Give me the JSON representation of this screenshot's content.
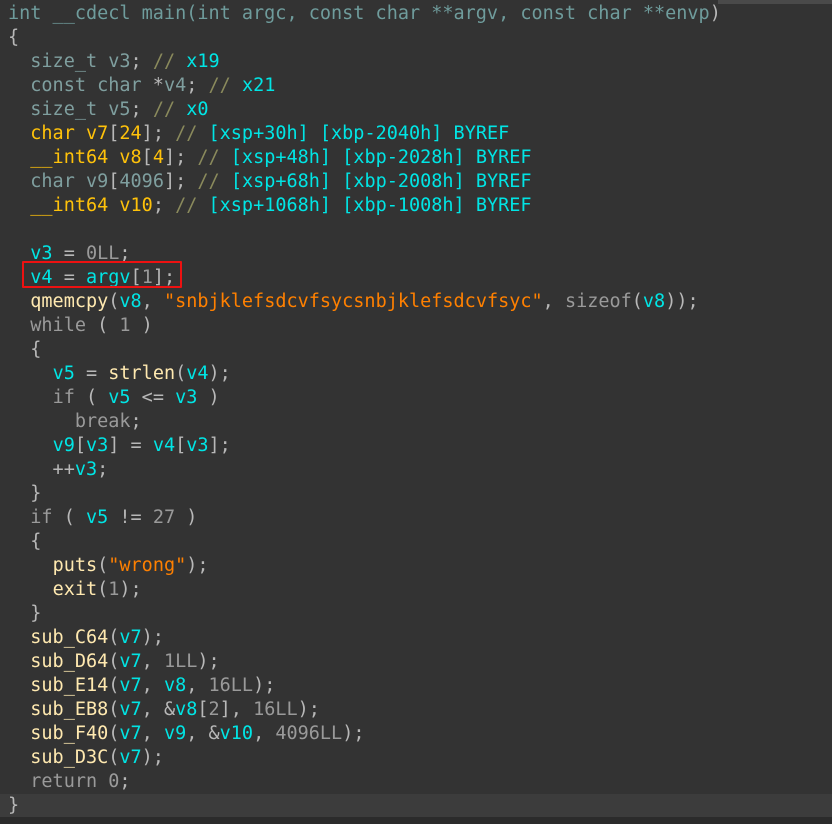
{
  "view": {
    "name": "pseudocode-view",
    "theme": "dark",
    "background_color": "#333333",
    "current_line_background": "#3c3c3c"
  },
  "colors": {
    "prototype": "#6f9c9c",
    "punctuation": "#b8b8b8",
    "keyword": "#9a9a9a",
    "type": "#7f9f9f",
    "stack_variable": "#ffc20a",
    "number": "#9a9a9a",
    "comment": "#8a8a5c",
    "address_comment": "#00e5e5",
    "variable": "#00e5e5",
    "function": "#ffe9b0",
    "string_literal": "#ff8000",
    "highlight_rectangle": "#ee1111"
  },
  "highlight": {
    "name": "red-annotation-rectangle",
    "target_line_index": 11,
    "target_text": "v4 = argv[1];"
  },
  "code": {
    "lines": [
      {
        "index": 0,
        "text": "int __cdecl main(int argc, const char **argv, const char **envp)",
        "tokens": [
          {
            "t": "int __cdecl main(int argc, const char **argv, const char **envp",
            "c": "t-proto"
          },
          {
            "t": ")",
            "c": "t-punct"
          }
        ]
      },
      {
        "index": 1,
        "text": "{",
        "tokens": [
          {
            "t": "{",
            "c": "t-punct"
          }
        ]
      },
      {
        "index": 2,
        "text": "  size_t v3; // x19",
        "tokens": [
          {
            "t": "  ",
            "c": "t-punct"
          },
          {
            "t": "size_t",
            "c": "t-type"
          },
          {
            "t": " ",
            "c": "t-punct"
          },
          {
            "t": "v3",
            "c": "t-localvar"
          },
          {
            "t": "; ",
            "c": "t-punct"
          },
          {
            "t": "//",
            "c": "t-comment"
          },
          {
            "t": " ",
            "c": "t-punct"
          },
          {
            "t": "x19",
            "c": "t-addr"
          }
        ]
      },
      {
        "index": 3,
        "text": "  const char *v4; // x21",
        "tokens": [
          {
            "t": "  ",
            "c": "t-punct"
          },
          {
            "t": "const char",
            "c": "t-type"
          },
          {
            "t": " *",
            "c": "t-punct"
          },
          {
            "t": "v4",
            "c": "t-localvar"
          },
          {
            "t": "; ",
            "c": "t-punct"
          },
          {
            "t": "//",
            "c": "t-comment"
          },
          {
            "t": " ",
            "c": "t-punct"
          },
          {
            "t": "x21",
            "c": "t-addr"
          }
        ]
      },
      {
        "index": 4,
        "text": "  size_t v5; // x0",
        "tokens": [
          {
            "t": "  ",
            "c": "t-punct"
          },
          {
            "t": "size_t",
            "c": "t-type"
          },
          {
            "t": " ",
            "c": "t-punct"
          },
          {
            "t": "v5",
            "c": "t-localvar"
          },
          {
            "t": "; ",
            "c": "t-punct"
          },
          {
            "t": "//",
            "c": "t-comment"
          },
          {
            "t": " ",
            "c": "t-punct"
          },
          {
            "t": "x0",
            "c": "t-addr"
          }
        ]
      },
      {
        "index": 5,
        "text": "  char v7[24]; // [xsp+30h] [xbp-2040h] BYREF",
        "tokens": [
          {
            "t": "  ",
            "c": "t-punct"
          },
          {
            "t": "char v7",
            "c": "t-stackvar"
          },
          {
            "t": "[",
            "c": "t-punct"
          },
          {
            "t": "24",
            "c": "t-stackvar"
          },
          {
            "t": "]",
            "c": "t-punct"
          },
          {
            "t": "; ",
            "c": "t-punct"
          },
          {
            "t": "//",
            "c": "t-comment"
          },
          {
            "t": " ",
            "c": "t-punct"
          },
          {
            "t": "[xsp+30h] [xbp-2040h] BYREF",
            "c": "t-addr"
          }
        ]
      },
      {
        "index": 6,
        "text": "  __int64 v8[4]; // [xsp+48h] [xbp-2028h] BYREF",
        "tokens": [
          {
            "t": "  ",
            "c": "t-punct"
          },
          {
            "t": "__int64 v8",
            "c": "t-stackvar"
          },
          {
            "t": "[",
            "c": "t-punct"
          },
          {
            "t": "4",
            "c": "t-stackvar"
          },
          {
            "t": "]",
            "c": "t-punct"
          },
          {
            "t": "; ",
            "c": "t-punct"
          },
          {
            "t": "//",
            "c": "t-comment"
          },
          {
            "t": " ",
            "c": "t-punct"
          },
          {
            "t": "[xsp+48h] [xbp-2028h] BYREF",
            "c": "t-addr"
          }
        ]
      },
      {
        "index": 7,
        "text": "  char v9[4096]; // [xsp+68h] [xbp-2008h] BYREF",
        "tokens": [
          {
            "t": "  ",
            "c": "t-punct"
          },
          {
            "t": "char",
            "c": "t-type"
          },
          {
            "t": " ",
            "c": "t-punct"
          },
          {
            "t": "v9",
            "c": "t-localvar"
          },
          {
            "t": "[",
            "c": "t-punct"
          },
          {
            "t": "4096",
            "c": "t-localvar"
          },
          {
            "t": "]",
            "c": "t-punct"
          },
          {
            "t": "; ",
            "c": "t-punct"
          },
          {
            "t": "//",
            "c": "t-comment"
          },
          {
            "t": " ",
            "c": "t-punct"
          },
          {
            "t": "[xsp+68h] [xbp-2008h] BYREF",
            "c": "t-addr"
          }
        ]
      },
      {
        "index": 8,
        "text": "  __int64 v10; // [xsp+1068h] [xbp-1008h] BYREF",
        "tokens": [
          {
            "t": "  ",
            "c": "t-punct"
          },
          {
            "t": "__int64 v10",
            "c": "t-stackvar"
          },
          {
            "t": "; ",
            "c": "t-punct"
          },
          {
            "t": "//",
            "c": "t-comment"
          },
          {
            "t": " ",
            "c": "t-punct"
          },
          {
            "t": "[xsp+1068h] [xbp-1008h] BYREF",
            "c": "t-addr"
          }
        ]
      },
      {
        "index": 9,
        "text": "",
        "tokens": []
      },
      {
        "index": 10,
        "text": "  v3 = 0LL;",
        "tokens": [
          {
            "t": "  ",
            "c": "t-punct"
          },
          {
            "t": "v3",
            "c": "t-var"
          },
          {
            "t": " = ",
            "c": "t-punct"
          },
          {
            "t": "0LL",
            "c": "t-number"
          },
          {
            "t": ";",
            "c": "t-punct"
          }
        ]
      },
      {
        "index": 11,
        "text": "  v4 = argv[1];",
        "tokens": [
          {
            "t": "  ",
            "c": "t-punct"
          },
          {
            "t": "v4",
            "c": "t-var"
          },
          {
            "t": " = ",
            "c": "t-punct"
          },
          {
            "t": "argv",
            "c": "t-var"
          },
          {
            "t": "[",
            "c": "t-punct"
          },
          {
            "t": "1",
            "c": "t-number"
          },
          {
            "t": "];",
            "c": "t-punct"
          }
        ]
      },
      {
        "index": 12,
        "text": "  qmemcpy(v8, \"snbjklefsdcvfsycsnbjklefsdcvfsyc\", sizeof(v8));",
        "tokens": [
          {
            "t": "  ",
            "c": "t-punct"
          },
          {
            "t": "qmemcpy",
            "c": "t-func"
          },
          {
            "t": "(",
            "c": "t-punct"
          },
          {
            "t": "v8",
            "c": "t-var"
          },
          {
            "t": ", ",
            "c": "t-punct"
          },
          {
            "t": "\"snbjklefsdcvfsycsnbjklefsdcvfsyc\"",
            "c": "t-string"
          },
          {
            "t": ", ",
            "c": "t-punct"
          },
          {
            "t": "sizeof",
            "c": "t-keyword"
          },
          {
            "t": "(",
            "c": "t-punct"
          },
          {
            "t": "v8",
            "c": "t-var"
          },
          {
            "t": "));",
            "c": "t-punct"
          }
        ]
      },
      {
        "index": 13,
        "text": "  while ( 1 )",
        "tokens": [
          {
            "t": "  ",
            "c": "t-punct"
          },
          {
            "t": "while",
            "c": "t-keyword"
          },
          {
            "t": " ( ",
            "c": "t-punct"
          },
          {
            "t": "1",
            "c": "t-number"
          },
          {
            "t": " )",
            "c": "t-punct"
          }
        ]
      },
      {
        "index": 14,
        "text": "  {",
        "tokens": [
          {
            "t": "  {",
            "c": "t-punct"
          }
        ]
      },
      {
        "index": 15,
        "text": "    v5 = strlen(v4);",
        "tokens": [
          {
            "t": "    ",
            "c": "t-punct"
          },
          {
            "t": "v5",
            "c": "t-var"
          },
          {
            "t": " = ",
            "c": "t-punct"
          },
          {
            "t": "strlen",
            "c": "t-func"
          },
          {
            "t": "(",
            "c": "t-punct"
          },
          {
            "t": "v4",
            "c": "t-var"
          },
          {
            "t": ");",
            "c": "t-punct"
          }
        ]
      },
      {
        "index": 16,
        "text": "    if ( v5 <= v3 )",
        "tokens": [
          {
            "t": "    ",
            "c": "t-punct"
          },
          {
            "t": "if",
            "c": "t-keyword"
          },
          {
            "t": " ( ",
            "c": "t-punct"
          },
          {
            "t": "v5",
            "c": "t-var"
          },
          {
            "t": " <= ",
            "c": "t-punct"
          },
          {
            "t": "v3",
            "c": "t-var"
          },
          {
            "t": " )",
            "c": "t-punct"
          }
        ]
      },
      {
        "index": 17,
        "text": "      break;",
        "tokens": [
          {
            "t": "      ",
            "c": "t-punct"
          },
          {
            "t": "break",
            "c": "t-keyword"
          },
          {
            "t": ";",
            "c": "t-punct"
          }
        ]
      },
      {
        "index": 18,
        "text": "    v9[v3] = v4[v3];",
        "tokens": [
          {
            "t": "    ",
            "c": "t-punct"
          },
          {
            "t": "v9",
            "c": "t-var"
          },
          {
            "t": "[",
            "c": "t-punct"
          },
          {
            "t": "v3",
            "c": "t-var"
          },
          {
            "t": "] = ",
            "c": "t-punct"
          },
          {
            "t": "v4",
            "c": "t-var"
          },
          {
            "t": "[",
            "c": "t-punct"
          },
          {
            "t": "v3",
            "c": "t-var"
          },
          {
            "t": "];",
            "c": "t-punct"
          }
        ]
      },
      {
        "index": 19,
        "text": "    ++v3;",
        "tokens": [
          {
            "t": "    ++",
            "c": "t-punct"
          },
          {
            "t": "v3",
            "c": "t-var"
          },
          {
            "t": ";",
            "c": "t-punct"
          }
        ]
      },
      {
        "index": 20,
        "text": "  }",
        "tokens": [
          {
            "t": "  }",
            "c": "t-punct"
          }
        ]
      },
      {
        "index": 21,
        "text": "  if ( v5 != 27 )",
        "tokens": [
          {
            "t": "  ",
            "c": "t-punct"
          },
          {
            "t": "if",
            "c": "t-keyword"
          },
          {
            "t": " ( ",
            "c": "t-punct"
          },
          {
            "t": "v5",
            "c": "t-var"
          },
          {
            "t": " != ",
            "c": "t-punct"
          },
          {
            "t": "27",
            "c": "t-number"
          },
          {
            "t": " )",
            "c": "t-punct"
          }
        ]
      },
      {
        "index": 22,
        "text": "  {",
        "tokens": [
          {
            "t": "  {",
            "c": "t-punct"
          }
        ]
      },
      {
        "index": 23,
        "text": "    puts(\"wrong\");",
        "tokens": [
          {
            "t": "    ",
            "c": "t-punct"
          },
          {
            "t": "puts",
            "c": "t-func"
          },
          {
            "t": "(",
            "c": "t-punct"
          },
          {
            "t": "\"wrong\"",
            "c": "t-string"
          },
          {
            "t": ");",
            "c": "t-punct"
          }
        ]
      },
      {
        "index": 24,
        "text": "    exit(1);",
        "tokens": [
          {
            "t": "    ",
            "c": "t-punct"
          },
          {
            "t": "exit",
            "c": "t-func"
          },
          {
            "t": "(",
            "c": "t-punct"
          },
          {
            "t": "1",
            "c": "t-number"
          },
          {
            "t": ");",
            "c": "t-punct"
          }
        ]
      },
      {
        "index": 25,
        "text": "  }",
        "tokens": [
          {
            "t": "  }",
            "c": "t-punct"
          }
        ]
      },
      {
        "index": 26,
        "text": "  sub_C64(v7);",
        "tokens": [
          {
            "t": "  ",
            "c": "t-punct"
          },
          {
            "t": "sub_C64",
            "c": "t-func"
          },
          {
            "t": "(",
            "c": "t-punct"
          },
          {
            "t": "v7",
            "c": "t-var"
          },
          {
            "t": ");",
            "c": "t-punct"
          }
        ]
      },
      {
        "index": 27,
        "text": "  sub_D64(v7, 1LL);",
        "tokens": [
          {
            "t": "  ",
            "c": "t-punct"
          },
          {
            "t": "sub_D64",
            "c": "t-func"
          },
          {
            "t": "(",
            "c": "t-punct"
          },
          {
            "t": "v7",
            "c": "t-var"
          },
          {
            "t": ", ",
            "c": "t-punct"
          },
          {
            "t": "1LL",
            "c": "t-number"
          },
          {
            "t": ");",
            "c": "t-punct"
          }
        ]
      },
      {
        "index": 28,
        "text": "  sub_E14(v7, v8, 16LL);",
        "tokens": [
          {
            "t": "  ",
            "c": "t-punct"
          },
          {
            "t": "sub_E14",
            "c": "t-func"
          },
          {
            "t": "(",
            "c": "t-punct"
          },
          {
            "t": "v7",
            "c": "t-var"
          },
          {
            "t": ", ",
            "c": "t-punct"
          },
          {
            "t": "v8",
            "c": "t-var"
          },
          {
            "t": ", ",
            "c": "t-punct"
          },
          {
            "t": "16LL",
            "c": "t-number"
          },
          {
            "t": ");",
            "c": "t-punct"
          }
        ]
      },
      {
        "index": 29,
        "text": "  sub_EB8(v7, &v8[2], 16LL);",
        "tokens": [
          {
            "t": "  ",
            "c": "t-punct"
          },
          {
            "t": "sub_EB8",
            "c": "t-func"
          },
          {
            "t": "(",
            "c": "t-punct"
          },
          {
            "t": "v7",
            "c": "t-var"
          },
          {
            "t": ", &",
            "c": "t-punct"
          },
          {
            "t": "v8",
            "c": "t-var"
          },
          {
            "t": "[",
            "c": "t-punct"
          },
          {
            "t": "2",
            "c": "t-number"
          },
          {
            "t": "], ",
            "c": "t-punct"
          },
          {
            "t": "16LL",
            "c": "t-number"
          },
          {
            "t": ");",
            "c": "t-punct"
          }
        ]
      },
      {
        "index": 30,
        "text": "  sub_F40(v7, v9, &v10, 4096LL);",
        "tokens": [
          {
            "t": "  ",
            "c": "t-punct"
          },
          {
            "t": "sub_F40",
            "c": "t-func"
          },
          {
            "t": "(",
            "c": "t-punct"
          },
          {
            "t": "v7",
            "c": "t-var"
          },
          {
            "t": ", ",
            "c": "t-punct"
          },
          {
            "t": "v9",
            "c": "t-var"
          },
          {
            "t": ", &",
            "c": "t-punct"
          },
          {
            "t": "v10",
            "c": "t-var"
          },
          {
            "t": ", ",
            "c": "t-punct"
          },
          {
            "t": "4096LL",
            "c": "t-number"
          },
          {
            "t": ");",
            "c": "t-punct"
          }
        ]
      },
      {
        "index": 31,
        "text": "  sub_D3C(v7);",
        "tokens": [
          {
            "t": "  ",
            "c": "t-punct"
          },
          {
            "t": "sub_D3C",
            "c": "t-func"
          },
          {
            "t": "(",
            "c": "t-punct"
          },
          {
            "t": "v7",
            "c": "t-var"
          },
          {
            "t": ");",
            "c": "t-punct"
          }
        ]
      },
      {
        "index": 32,
        "text": "  return 0;",
        "tokens": [
          {
            "t": "  ",
            "c": "t-punct"
          },
          {
            "t": "return",
            "c": "t-keyword"
          },
          {
            "t": " ",
            "c": "t-punct"
          },
          {
            "t": "0",
            "c": "t-number"
          },
          {
            "t": ";",
            "c": "t-punct"
          }
        ]
      },
      {
        "index": 33,
        "text": "}",
        "current": true,
        "tokens": [
          {
            "t": "}",
            "c": "t-punct"
          }
        ]
      }
    ]
  }
}
